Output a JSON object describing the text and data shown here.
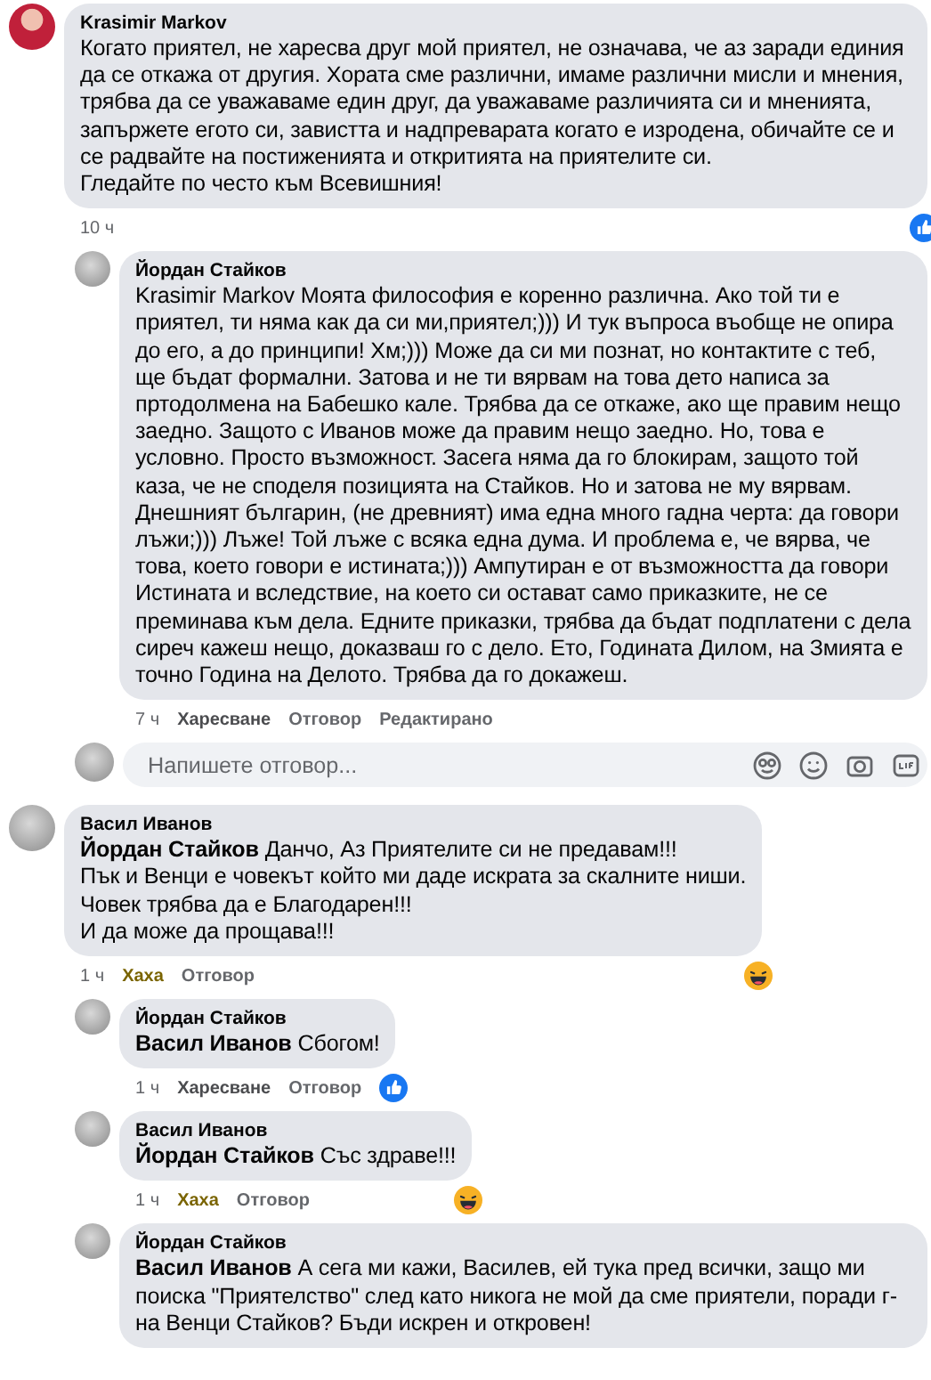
{
  "threads": [
    {
      "author": "Krasimir Markov",
      "text": "Когато приятел, не харесва друг мой приятел, не означава, че аз заради единия да се откажа от другия. Хората сме различни, имаме различни мисли и мнения, трябва да се уважаваме един друг, да уважаваме различията си и мненията, запържете егото си, завистта и надпреварата когато е изродена, обичайте се и се радвайте на постиженията и откритията на приятелите си.\nГледайте по често към Всевишния!",
      "time": "10 ч",
      "reaction_badge": {
        "kind": "like"
      },
      "replies": [
        {
          "author": "Йордан Стайков",
          "text": "Krasimir Markov Моята философия е коренно различна. Ако той ти е приятел, ти няма как да си ми,приятел;))) И тук въпроса въобще не опира до его, а до принципи! Хм;))) Може да си ми познат, но контактите с теб, ще бъдат формални. Затова и не ти вярвам на това дето написа за пртодолмена на Бабешко кале. Трябва да се откаже, ако ще правим нещо заедно. Защото с Иванов може да правим нещо заедно. Но, това е условно. Просто възможност. Засега няма да го блокирам, защото той каза, че не споделя позицията на Стайков. Но и затова не му вярвам. Днешният българин, (не древният) има една много гадна черта: да говори лъжи;))) Лъже! Той лъже с всяка една дума. И проблема е, че вярва, че това, което говори е истината;))) Ампутиран е от възможността да говори Истината и вследствие, на което си остават само приказките, не се преминава към дела. Едните приказки, трябва да бъдат подплатени с дела сиреч кажеш нещо, доказваш го с дело. Ето, Годината Дилом, на Змията е точно Година на Делото. Трябва да го докажеш.",
          "time": "7 ч",
          "actions": [
            {
              "label": "Харесване",
              "kind": "like",
              "selected": false
            },
            {
              "label": "Отговор",
              "kind": "reply",
              "selected": false
            },
            {
              "label": "Редактирано",
              "kind": "edited",
              "selected": false
            }
          ]
        }
      ],
      "reply_field": {
        "placeholder": "Напишете отговор..."
      }
    },
    {
      "author": "Васил Иванов",
      "text": "**Йордан Стайков** Данчо, Аз Приятелите си не предавам!!!\nПък и Венци е човекът който ми даде искрата за скалните ниши.\nЧовек трябва да е Благодарен!!!\nИ да може да прощава!!!",
      "time": "1 ч",
      "actions": [
        {
          "label": "Хаха",
          "kind": "like",
          "selected": true
        },
        {
          "label": "Отговор",
          "kind": "reply",
          "selected": false
        }
      ],
      "reaction_badge": {
        "kind": "haha"
      },
      "replies": [
        {
          "author": "Йордан Стайков",
          "text": "**Васил Иванов** Сбогом!",
          "time": "1 ч",
          "actions": [
            {
              "label": "Харесване",
              "kind": "like",
              "selected": false
            },
            {
              "label": "Отговор",
              "kind": "reply",
              "selected": false
            }
          ],
          "reaction_badge": {
            "kind": "like"
          }
        },
        {
          "author": "Васил Иванов",
          "text": "**Йордан Стайков** Със здраве!!!",
          "time": "1 ч",
          "actions": [
            {
              "label": "Хаха",
              "kind": "like",
              "selected": true
            },
            {
              "label": "Отговор",
              "kind": "reply",
              "selected": false
            }
          ],
          "reaction_badge": {
            "kind": "haha"
          }
        },
        {
          "author": "Йордан Стайков",
          "text": "**Васил Иванов** А сега ми кажи, Василев, ей тука пред всички, защо ми поиска \"Приятелство\" след като никога не мой да сме приятели, поради г-на Венци Стайков? Бъди искрен и откровен!"
        }
      ]
    }
  ]
}
